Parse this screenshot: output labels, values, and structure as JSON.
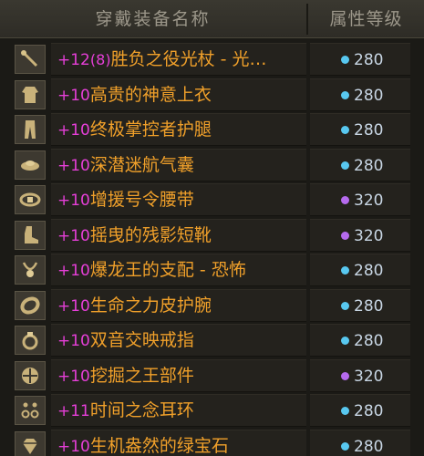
{
  "header": {
    "name_col": "穿戴装备名称",
    "level_col": "属性等级"
  },
  "colors": {
    "blue_dot": "#58c8f0",
    "purple_dot": "#b56aee"
  },
  "items": [
    {
      "icon": "staff-icon",
      "plus": "+12",
      "paren": "(8)",
      "name": "胜负之役光杖 - 光…",
      "level": "280",
      "dot": "blue"
    },
    {
      "icon": "coat-icon",
      "plus": "+10",
      "paren": "",
      "name": "高贵的神意上衣",
      "level": "280",
      "dot": "blue"
    },
    {
      "icon": "pants-icon",
      "plus": "+10",
      "paren": "",
      "name": "终极掌控者护腿",
      "level": "280",
      "dot": "blue"
    },
    {
      "icon": "shoulder-icon",
      "plus": "+10",
      "paren": "",
      "name": "深潜迷航气囊",
      "level": "280",
      "dot": "blue"
    },
    {
      "icon": "belt-icon",
      "plus": "+10",
      "paren": "",
      "name": "增援号令腰带",
      "level": "320",
      "dot": "purple"
    },
    {
      "icon": "boots-icon",
      "plus": "+10",
      "paren": "",
      "name": "摇曳的残影短靴",
      "level": "320",
      "dot": "purple"
    },
    {
      "icon": "necklace-icon",
      "plus": "+10",
      "paren": "",
      "name": "爆龙王的支配 - 恐怖",
      "level": "280",
      "dot": "blue"
    },
    {
      "icon": "bracelet-icon",
      "plus": "+10",
      "paren": "",
      "name": "生命之力皮护腕",
      "level": "280",
      "dot": "blue"
    },
    {
      "icon": "ring-icon",
      "plus": "+10",
      "paren": "",
      "name": "双音交映戒指",
      "level": "280",
      "dot": "blue"
    },
    {
      "icon": "subequip-icon",
      "plus": "+10",
      "paren": "",
      "name": "挖掘之王部件",
      "level": "320",
      "dot": "purple"
    },
    {
      "icon": "earring-icon",
      "plus": "+11",
      "paren": "",
      "name": "时间之念耳环",
      "level": "280",
      "dot": "blue"
    },
    {
      "icon": "gem-icon",
      "plus": "+10",
      "paren": "",
      "name": "生机盎然的绿宝石",
      "level": "280",
      "dot": "blue"
    }
  ]
}
